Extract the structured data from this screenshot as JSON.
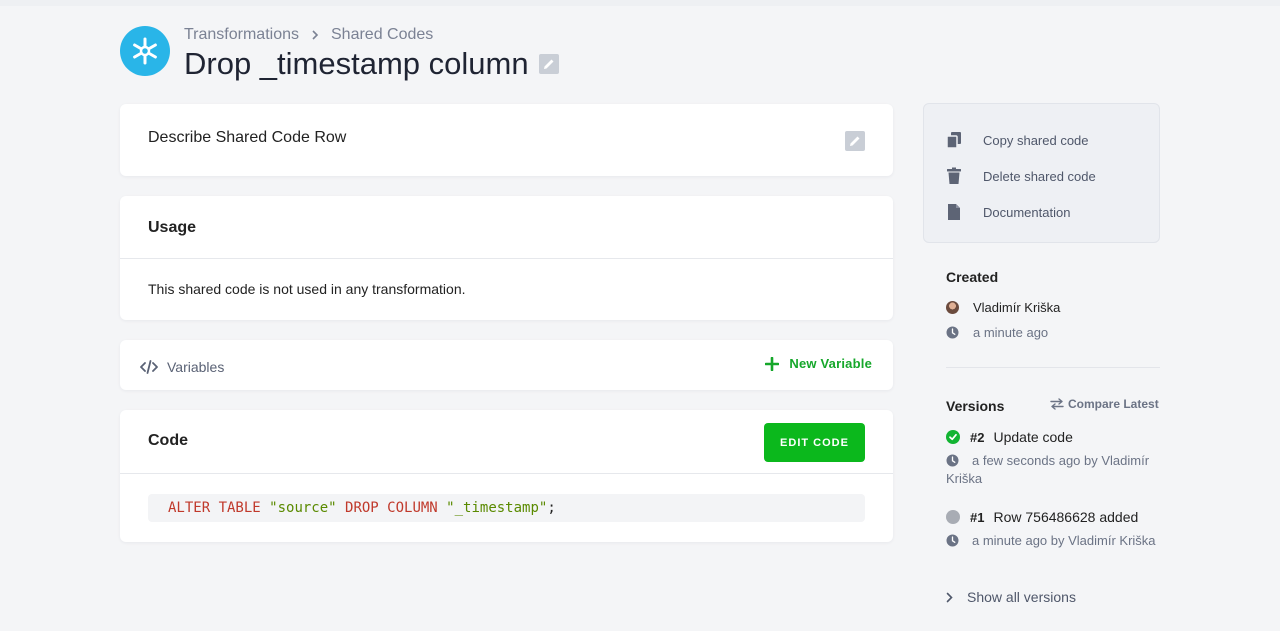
{
  "header": {
    "breadcrumb": [
      "Transformations",
      "Shared Codes"
    ],
    "title": "Drop _timestamp column"
  },
  "describe": {
    "title": "Describe Shared Code Row"
  },
  "usage": {
    "title": "Usage",
    "text": "This shared code is not used in any transformation."
  },
  "variables": {
    "label": "Variables",
    "new_label": "New Variable"
  },
  "code": {
    "title": "Code",
    "edit_button": "EDIT CODE",
    "tokens": {
      "alter": "ALTER TABLE ",
      "table_name": "\"source\"",
      "drop": " DROP COLUMN ",
      "column": "\"_timestamp\"",
      "end": ";"
    }
  },
  "sidebar": {
    "actions": [
      "Copy shared code",
      "Delete shared code",
      "Documentation"
    ],
    "created_label": "Created",
    "creator": "Vladimír Kriška",
    "created_time": "a minute ago",
    "versions_label": "Versions",
    "compare_label": "Compare Latest",
    "versions": [
      {
        "number": "#2",
        "title": "Update code",
        "meta": "a few seconds ago by Vladimír Kriška",
        "status": "success"
      },
      {
        "number": "#1",
        "title": "Row 756486628 added",
        "meta": "a minute ago by Vladimír Kriška",
        "status": "neutral"
      }
    ],
    "show_all": "Show all versions"
  },
  "colors": {
    "accent_green": "#0bb81c",
    "brand_blue": "#29b5e8",
    "keyword": "#c0392b",
    "string": "#5a8a00"
  }
}
